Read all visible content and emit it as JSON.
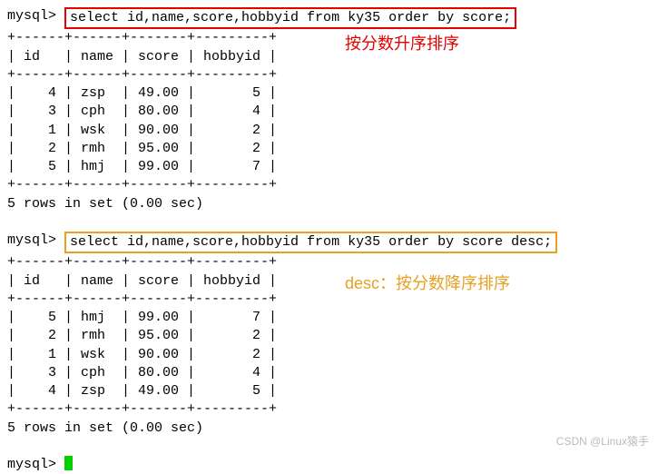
{
  "prompt": "mysql> ",
  "query1": {
    "sql": "select id,name,score,hobbyid from ky35 order by score;",
    "annotation": "按分数升序排序",
    "border": "+------+------+-------+---------+",
    "header": "| id   | name | score | hobbyid |",
    "rows": [
      "|    4 | zsp  | 49.00 |       5 |",
      "|    3 | cph  | 80.00 |       4 |",
      "|    1 | wsk  | 90.00 |       2 |",
      "|    2 | rmh  | 95.00 |       2 |",
      "|    5 | hmj  | 99.00 |       7 |"
    ],
    "footer": "5 rows in set (0.00 sec)"
  },
  "query2": {
    "sql": "select id,name,score,hobbyid from ky35 order by score desc;",
    "annotation": "desc：按分数降序排序",
    "border": "+------+------+-------+---------+",
    "header": "| id   | name | score | hobbyid |",
    "rows": [
      "|    5 | hmj  | 99.00 |       7 |",
      "|    2 | rmh  | 95.00 |       2 |",
      "|    1 | wsk  | 90.00 |       2 |",
      "|    3 | cph  | 80.00 |       4 |",
      "|    4 | zsp  | 49.00 |       5 |"
    ],
    "footer": "5 rows in set (0.00 sec)"
  },
  "watermark": "CSDN @Linux猿手",
  "chart_data": [
    {
      "type": "table",
      "title": "ky35 ordered by score asc",
      "columns": [
        "id",
        "name",
        "score",
        "hobbyid"
      ],
      "rows": [
        [
          4,
          "zsp",
          49.0,
          5
        ],
        [
          3,
          "cph",
          80.0,
          4
        ],
        [
          1,
          "wsk",
          90.0,
          2
        ],
        [
          2,
          "rmh",
          95.0,
          2
        ],
        [
          5,
          "hmj",
          99.0,
          7
        ]
      ]
    },
    {
      "type": "table",
      "title": "ky35 ordered by score desc",
      "columns": [
        "id",
        "name",
        "score",
        "hobbyid"
      ],
      "rows": [
        [
          5,
          "hmj",
          99.0,
          7
        ],
        [
          2,
          "rmh",
          95.0,
          2
        ],
        [
          1,
          "wsk",
          90.0,
          2
        ],
        [
          3,
          "cph",
          80.0,
          4
        ],
        [
          4,
          "zsp",
          49.0,
          5
        ]
      ]
    }
  ]
}
